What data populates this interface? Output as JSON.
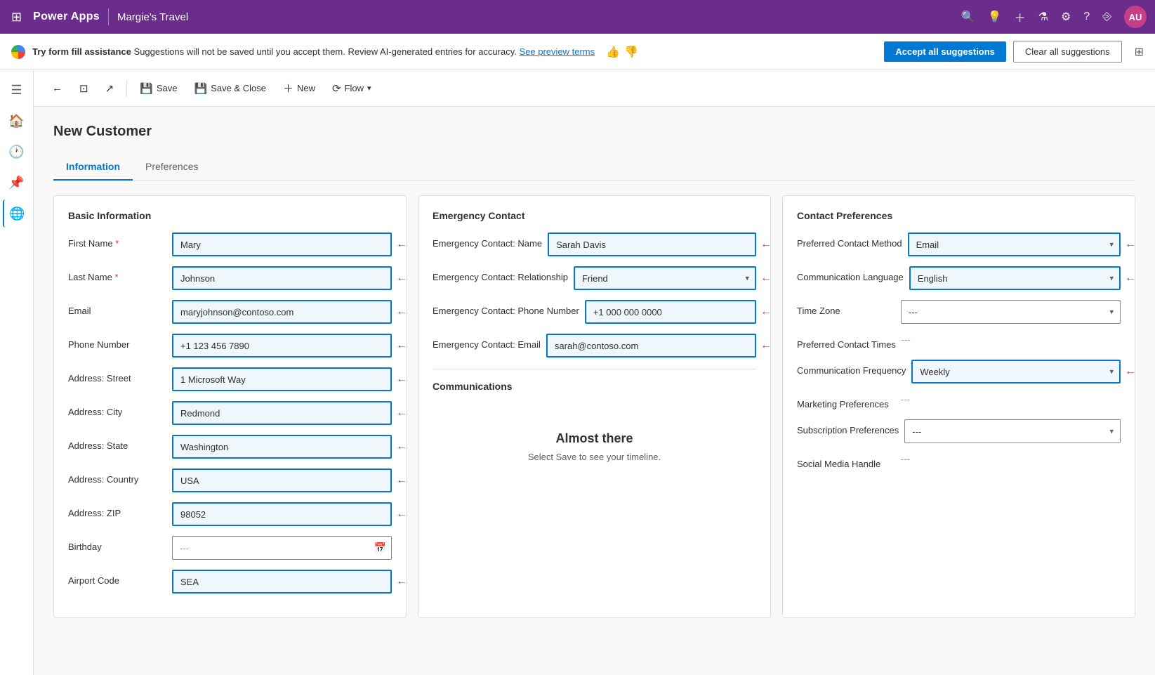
{
  "topbar": {
    "brand": "Power Apps",
    "app_name": "Margie's Travel",
    "avatar_initials": "AU"
  },
  "ai_bar": {
    "label": "Try form fill assistance",
    "description": " Suggestions will not be saved until you accept them. Review AI-generated entries for accuracy. ",
    "link": "See preview terms",
    "accept_btn": "Accept all suggestions",
    "clear_btn": "Clear all suggestions"
  },
  "toolbar": {
    "back_label": "←",
    "save_label": "Save",
    "save_close_label": "Save & Close",
    "new_label": "New",
    "flow_label": "Flow"
  },
  "page": {
    "title": "New Customer",
    "tabs": [
      "Information",
      "Preferences"
    ]
  },
  "basic_info": {
    "section_title": "Basic Information",
    "fields": {
      "first_name": {
        "label": "First Name",
        "value": "Mary",
        "required": true,
        "highlighted": true
      },
      "last_name": {
        "label": "Last Name",
        "value": "Johnson",
        "required": true,
        "highlighted": true
      },
      "email": {
        "label": "Email",
        "value": "maryjohnson@contoso.com",
        "highlighted": true
      },
      "phone": {
        "label": "Phone Number",
        "value": "+1 123 456 7890",
        "highlighted": true
      },
      "street": {
        "label": "Address: Street",
        "value": "1 Microsoft Way",
        "highlighted": true
      },
      "city": {
        "label": "Address: City",
        "value": "Redmond",
        "highlighted": true
      },
      "state": {
        "label": "Address: State",
        "value": "Washington",
        "highlighted": true
      },
      "country": {
        "label": "Address: Country",
        "value": "USA",
        "highlighted": true
      },
      "zip": {
        "label": "Address: ZIP",
        "value": "98052",
        "highlighted": true
      },
      "birthday": {
        "label": "Birthday",
        "value": "---",
        "has_icon": true
      },
      "airport_code": {
        "label": "Airport Code",
        "value": "SEA",
        "highlighted": true
      }
    }
  },
  "emergency_contact": {
    "section_title": "Emergency Contact",
    "fields": {
      "name": {
        "label": "Emergency Contact: Name",
        "value": "Sarah Davis",
        "highlighted": true
      },
      "relationship": {
        "label": "Emergency Contact: Relationship",
        "value": "Friend",
        "highlighted": true
      },
      "phone": {
        "label": "Emergency Contact: Phone Number",
        "value": "+1 000 000 0000",
        "highlighted": true
      },
      "email": {
        "label": "Emergency Contact: Email",
        "value": "sarah@contoso.com",
        "highlighted": true
      }
    },
    "communications_title": "Communications",
    "almost_there_title": "Almost there",
    "almost_there_text": "Select Save to see your timeline."
  },
  "contact_preferences": {
    "section_title": "Contact Preferences",
    "fields": {
      "preferred_method": {
        "label": "Preferred Contact Method",
        "value": "Email",
        "highlighted": true
      },
      "language": {
        "label": "Communication Language",
        "value": "English",
        "highlighted": true
      },
      "timezone": {
        "label": "Time Zone",
        "value": "---"
      },
      "contact_times": {
        "label": "Preferred Contact Times",
        "value": "---"
      },
      "frequency": {
        "label": "Communication Frequency",
        "value": "Weekly",
        "highlighted": true
      },
      "marketing": {
        "label": "Marketing Preferences",
        "value": "---"
      },
      "subscription": {
        "label": "Subscription Preferences",
        "value": "---"
      },
      "social": {
        "label": "Social Media Handle",
        "value": "---"
      }
    }
  },
  "sidebar_icons": [
    "≡",
    "🏠",
    "🕐",
    "📌",
    "🌐"
  ]
}
